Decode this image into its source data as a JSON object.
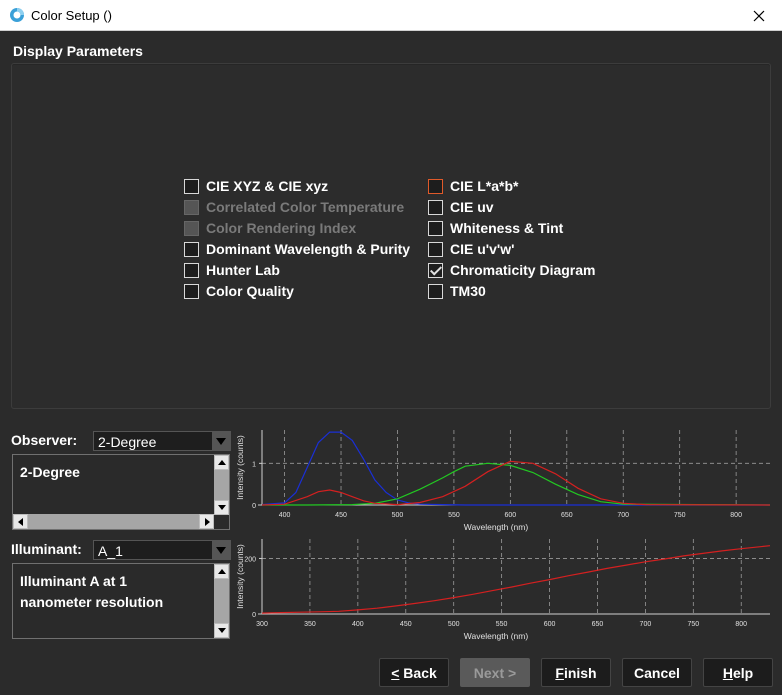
{
  "window": {
    "title": "Color Setup ()"
  },
  "section_title": "Display Parameters",
  "left_options": [
    {
      "label": "CIE XYZ & CIE xyz",
      "checked": false,
      "enabled": true
    },
    {
      "label": "Correlated Color Temperature",
      "checked": false,
      "enabled": false
    },
    {
      "label": "Color Rendering Index",
      "checked": false,
      "enabled": false
    },
    {
      "label": "Dominant Wavelength & Purity",
      "checked": false,
      "enabled": true
    },
    {
      "label": "Hunter Lab",
      "checked": false,
      "enabled": true
    },
    {
      "label": "Color Quality",
      "checked": false,
      "enabled": true
    }
  ],
  "right_options": [
    {
      "label": "CIE L*a*b*",
      "checked": false,
      "enabled": true,
      "focused": true
    },
    {
      "label": "CIE uv",
      "checked": false,
      "enabled": true
    },
    {
      "label": "Whiteness & Tint",
      "checked": false,
      "enabled": true
    },
    {
      "label": "CIE u'v'w'",
      "checked": false,
      "enabled": true
    },
    {
      "label": "Chromaticity Diagram",
      "checked": true,
      "enabled": true
    },
    {
      "label": "TM30",
      "checked": false,
      "enabled": true
    }
  ],
  "observer": {
    "label": "Observer:",
    "value": "2-Degree",
    "description": "2-Degree"
  },
  "illuminant": {
    "label": "Illuminant:",
    "value": "A_1",
    "description_line1": "Illuminant A at 1",
    "description_line2": "nanometer resolution"
  },
  "buttons": {
    "back": {
      "underline": "<",
      "rest": " Back",
      "pre": "",
      "enabled": true
    },
    "next": {
      "label": "Next >",
      "enabled": false
    },
    "finish": {
      "underline": "F",
      "rest": "inish",
      "enabled": true
    },
    "cancel": {
      "label": "Cancel",
      "enabled": true
    },
    "help": {
      "underline": "H",
      "rest": "elp",
      "enabled": true
    }
  },
  "chart_data": [
    {
      "type": "line",
      "xlabel": "Wavelength (nm)",
      "ylabel": "Intensity (counts)",
      "x_ticks": [
        400,
        450,
        500,
        550,
        600,
        650,
        700,
        750,
        800
      ],
      "y_ticks": [
        0,
        1
      ],
      "xlim": [
        380,
        830
      ],
      "ylim": [
        0,
        1.8
      ],
      "grid": true,
      "series": [
        {
          "color": "#1a2fd6",
          "x": [
            380,
            400,
            410,
            420,
            430,
            440,
            450,
            460,
            470,
            480,
            490,
            500,
            510,
            520,
            540,
            560,
            600,
            700,
            830
          ],
          "y": [
            0.01,
            0.05,
            0.3,
            0.9,
            1.5,
            1.75,
            1.75,
            1.55,
            1.1,
            0.6,
            0.3,
            0.12,
            0.05,
            0.02,
            0.01,
            0,
            0,
            0,
            0
          ]
        },
        {
          "color": "#22c822",
          "x": [
            380,
            420,
            460,
            480,
            500,
            520,
            540,
            550,
            560,
            580,
            600,
            620,
            640,
            660,
            680,
            700,
            830
          ],
          "y": [
            0,
            0,
            0.01,
            0.04,
            0.15,
            0.38,
            0.65,
            0.8,
            0.93,
            1.0,
            0.95,
            0.78,
            0.5,
            0.25,
            0.08,
            0.02,
            0
          ]
        },
        {
          "color": "#d42020",
          "x": [
            380,
            400,
            420,
            430,
            440,
            450,
            460,
            470,
            480,
            500,
            520,
            540,
            560,
            580,
            600,
            620,
            640,
            660,
            680,
            700,
            720,
            830
          ],
          "y": [
            0,
            0.02,
            0.2,
            0.32,
            0.36,
            0.3,
            0.2,
            0.1,
            0.04,
            0.01,
            0.06,
            0.2,
            0.45,
            0.8,
            1.05,
            1.0,
            0.75,
            0.4,
            0.15,
            0.04,
            0.01,
            0
          ]
        }
      ]
    },
    {
      "type": "line",
      "xlabel": "Wavelength (nm)",
      "ylabel": "Intensity (counts)",
      "x_ticks": [
        300,
        350,
        400,
        450,
        500,
        550,
        600,
        650,
        700,
        750,
        800
      ],
      "y_ticks": [
        0,
        200
      ],
      "xlim": [
        300,
        830
      ],
      "ylim": [
        0,
        270
      ],
      "grid": true,
      "series": [
        {
          "color": "#d42020",
          "x": [
            300,
            320,
            340,
            360,
            380,
            400,
            420,
            440,
            460,
            480,
            500,
            520,
            540,
            560,
            580,
            600,
            620,
            640,
            660,
            680,
            700,
            720,
            740,
            760,
            780,
            800,
            830
          ],
          "y": [
            3.3,
            5,
            6.5,
            8,
            9.8,
            14.7,
            21,
            29,
            38,
            48,
            59,
            71,
            84,
            97,
            111,
            124,
            138,
            151,
            164,
            176,
            188,
            198,
            209,
            218,
            227,
            235,
            246
          ]
        }
      ]
    }
  ]
}
